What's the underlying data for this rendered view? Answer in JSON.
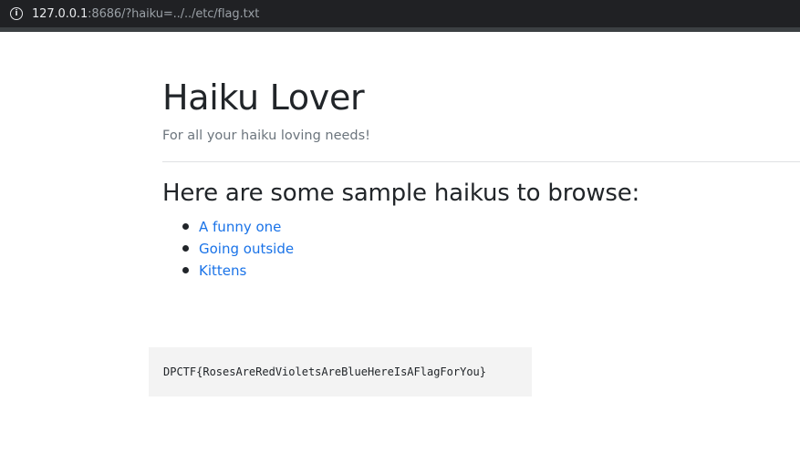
{
  "browser": {
    "info_icon": "info-icon",
    "url_host": "127.0.0.1",
    "url_rest": ":8686/?haiku=../../etc/flag.txt"
  },
  "page": {
    "title": "Haiku Lover",
    "tagline": "For all your haiku loving needs!",
    "section_heading": "Here are some sample haikus to browse:",
    "haikus": [
      {
        "label": "A funny one"
      },
      {
        "label": "Going outside"
      },
      {
        "label": "Kittens"
      }
    ],
    "output": "DPCTF{RosesAreRedVioletsAreBlueHereIsAFlagForYou}"
  },
  "colors": {
    "link": "#1a73e8",
    "heading": "#212529",
    "muted": "#6c757d",
    "bar_background": "#202124"
  }
}
